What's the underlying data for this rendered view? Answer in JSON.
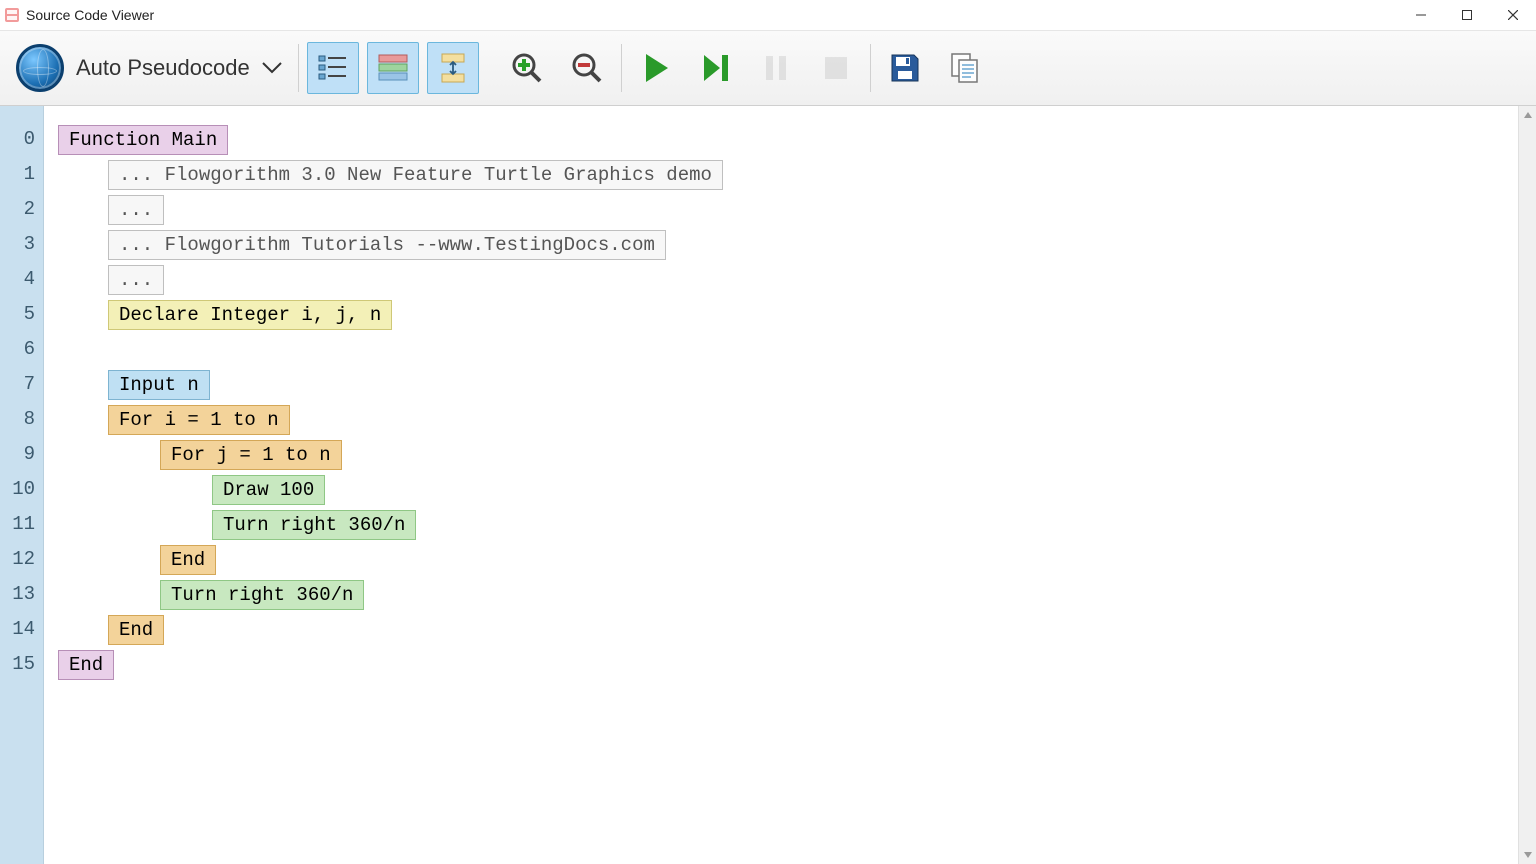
{
  "window": {
    "title": "Source Code Viewer"
  },
  "toolbar": {
    "language_label": "Auto Pseudocode"
  },
  "code": {
    "lines": [
      {
        "n": "0",
        "indent": 1,
        "style": "b-purple",
        "text": "Function Main"
      },
      {
        "n": "1",
        "indent": 2,
        "style": "b-gray",
        "text": "... Flowgorithm 3.0 New Feature Turtle Graphics demo"
      },
      {
        "n": "2",
        "indent": 2,
        "style": "b-gray",
        "text": "..."
      },
      {
        "n": "3",
        "indent": 2,
        "style": "b-gray",
        "text": "... Flowgorithm Tutorials --www.TestingDocs.com"
      },
      {
        "n": "4",
        "indent": 2,
        "style": "b-gray",
        "text": "..."
      },
      {
        "n": "5",
        "indent": 2,
        "style": "b-yellow",
        "text": "Declare Integer i, j, n"
      },
      {
        "n": "6",
        "indent": 0,
        "style": "",
        "text": ""
      },
      {
        "n": "7",
        "indent": 2,
        "style": "b-blue",
        "text": "Input n"
      },
      {
        "n": "8",
        "indent": 2,
        "style": "b-orange",
        "text": "For i = 1 to n"
      },
      {
        "n": "9",
        "indent": 3,
        "style": "b-orange",
        "text": "For j = 1 to n"
      },
      {
        "n": "10",
        "indent": 4,
        "style": "b-green",
        "text": "Draw 100"
      },
      {
        "n": "11",
        "indent": 4,
        "style": "b-green",
        "text": "Turn right 360/n"
      },
      {
        "n": "12",
        "indent": 3,
        "style": "b-orange",
        "text": "End"
      },
      {
        "n": "13",
        "indent": 3,
        "style": "b-green",
        "text": "Turn right 360/n"
      },
      {
        "n": "14",
        "indent": 2,
        "style": "b-orange",
        "text": "End"
      },
      {
        "n": "15",
        "indent": 1,
        "style": "b-purple",
        "text": "End"
      }
    ]
  }
}
